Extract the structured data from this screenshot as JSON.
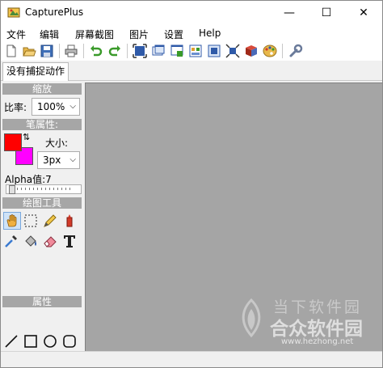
{
  "window": {
    "title": "CapturePlus",
    "minimize_glyph": "—",
    "maximize_glyph": "☐",
    "close_glyph": "✕"
  },
  "menu": [
    "文件",
    "编辑",
    "屏幕截图",
    "图片",
    "设置",
    "Help"
  ],
  "toolbar": {
    "icons": [
      "new-file-icon",
      "open-folder-icon",
      "save-icon",
      "print-icon",
      "undo-icon",
      "redo-icon",
      "capture-fullscreen-icon",
      "capture-window-icon",
      "capture-region-icon",
      "capture-object-icon",
      "capture-scroll-icon",
      "capture-freehand-icon",
      "capture-3d-icon",
      "paint-palette-icon",
      "settings-wrench-icon"
    ]
  },
  "tabs": {
    "active_label": "没有捕捉动作"
  },
  "left_panel": {
    "zoom_header": "缩放",
    "ratio_label": "比率:",
    "ratio_value": "100%",
    "pen_header": "笔属性:",
    "size_label": "大小:",
    "size_value": "3px",
    "alpha_label": "Alpha值:7",
    "tools_header": "绘图工具",
    "properties_header": "属性",
    "primary_color": "#ff0000",
    "secondary_color": "#ff00ff",
    "swap_glyph": "⇅"
  },
  "tools": [
    "hand-pan-icon",
    "rect-select-icon",
    "pencil-icon",
    "marker-icon",
    "eyedropper-icon",
    "fill-bucket-icon",
    "eraser-icon",
    "text-icon",
    "line-icon",
    "rectangle-icon",
    "ellipse-icon",
    "rounded-rect-icon",
    "arrow-icon",
    "stamp-icon"
  ],
  "watermark": {
    "line1": "当下软件园",
    "line2": "合众软件园",
    "url": "www.hezhong.net"
  },
  "colors": {
    "canvas_bg": "#a5a5a5",
    "panel_header": "#a6a6a6"
  }
}
